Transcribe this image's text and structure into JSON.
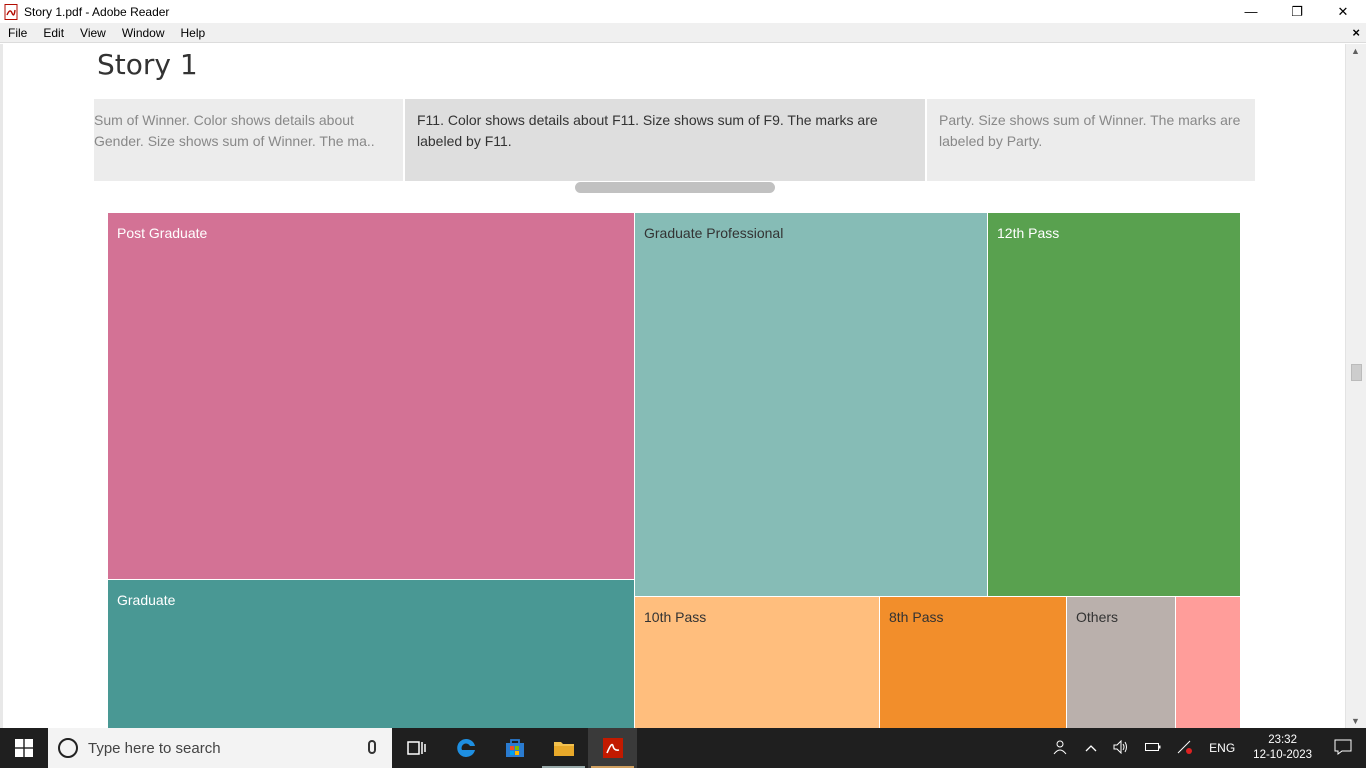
{
  "window": {
    "title": "Story 1.pdf - Adobe Reader",
    "minimize": "—",
    "restore": "❐",
    "close": "✕"
  },
  "menu": {
    "items": [
      "File",
      "Edit",
      "View",
      "Window",
      "Help"
    ],
    "close": "×"
  },
  "story": {
    "title": "Story 1",
    "points": [
      "Sum of Winner.  Color shows details about Gender.  Size shows sum of Winner.  The ma..",
      "F11.  Color shows details about F11.  Size shows sum of F9.  The marks are labeled by F11.",
      "Party.  Size shows sum of Winner.  The marks are labeled by Party."
    ]
  },
  "chart_data": {
    "type": "treemap",
    "items": [
      {
        "label": "Post Graduate",
        "color": "#d37295"
      },
      {
        "label": "Graduate",
        "color": "#499894"
      },
      {
        "label": "Graduate Professional",
        "color": "#86bcb6"
      },
      {
        "label": "12th Pass",
        "color": "#59a14f"
      },
      {
        "label": "10th Pass",
        "color": "#ffbe7d"
      },
      {
        "label": "8th Pass",
        "color": "#f28e2b"
      },
      {
        "label": "Others",
        "color": "#bab0ac"
      },
      {
        "label": "",
        "color": "#ff9d9a"
      }
    ]
  },
  "taskbar": {
    "search_placeholder": "Type here to search",
    "language": "ENG",
    "time": "23:32",
    "date": "12-10-2023"
  }
}
